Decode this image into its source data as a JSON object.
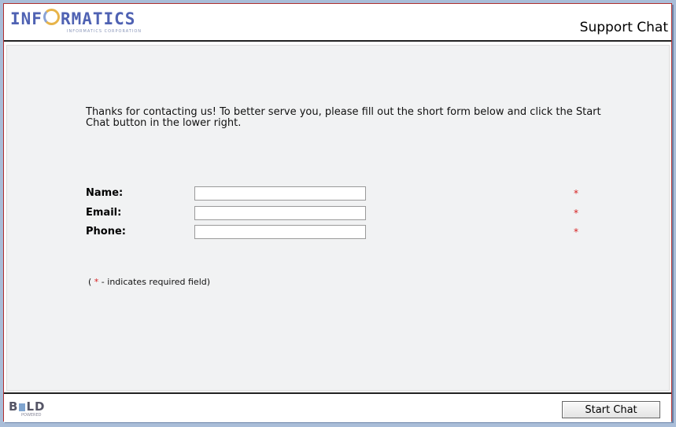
{
  "header": {
    "logo_text": "INFORMATICS",
    "logo_tagline": "INFORMATICS CORPORATION",
    "title": "Support Chat"
  },
  "form": {
    "intro": "Thanks for contacting us! To better serve you, please fill out the short form below and click the Start Chat button in the lower right.",
    "fields": [
      {
        "label": "Name:",
        "value": "",
        "required_mark": "*"
      },
      {
        "label": "Email:",
        "value": "",
        "required_mark": "*"
      },
      {
        "label": "Phone:",
        "value": "",
        "required_mark": "*"
      }
    ],
    "note_prefix": "( ",
    "note_star": "*",
    "note_suffix": " - indicates required field)"
  },
  "footer": {
    "brand": "BOLD",
    "brand_sub": "POWERED",
    "start_chat_label": "Start Chat"
  },
  "colors": {
    "required": "#d62020",
    "logo": "#4f62b3"
  }
}
